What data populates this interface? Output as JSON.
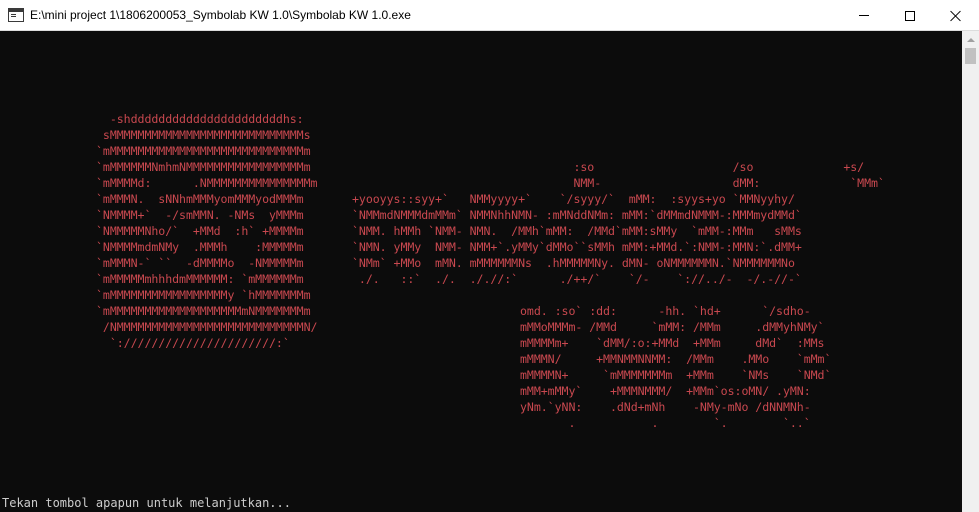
{
  "window": {
    "title": "E:\\mini project 1\\1806200053_Symbolab KW 1.0\\Symbolab KW 1.0.exe",
    "icon": "console-window-icon",
    "controls": [
      "minimize",
      "maximize",
      "close"
    ]
  },
  "console": {
    "text_color": "#c8484f",
    "background": "#0c0c0c",
    "ascii_logo_left": "  -shddddddddddddddddddddddhs:\n sMMMMMMMMMMMMMMMMMMMMMMMMMMMMs\n`mMMMMMMMMMMMMMMMMMMMMMMMMMMMMm\n`mMMMMMMNmhmNMMMMMMMMMMMMMMMMMm\n`mMMMMd:      .NMMMMMMMMMMMMMMMm\n`mMMMN.  sNNhmMMMyomMMMyodMMMm\n`NMMMM+`  -/smMMN. -NMs  yMMMm\n`NMMMMMNho/`  +MMd  :h` +MMMMm\n`NMMMMmdmNMy  .MMMh    :MMMMMm\n`mMMMN-` ``  -dMMMMo  -NMMMMMm\n`mMMMMMmhhhdmMMMMMM: `mMMMMMMm\n`mMMMMMMMMMMMMMMMMMy `hMMMMMMMm\n`mMMMMMMMMMMMMMMMMMMMmNMMMMMMMm\n /NMMMMMMMMMMMMMMMMMMMMMMMMMMMN/\n  `://////////////////////:`",
    "ascii_logo_right": "                                :so                    /so             +s/\n                                NMM-                   dMM:             `MMm`\n+yooyys::syy+`   NMMyyyy+`    `/syyy/`  mMM:  :syys+yo `MMNyyhy/\n`NMMmdNMMMdmMMm` NMMNhhNMN- :mMNddNMm: mMM:`dMMmdNMMM-:MMMmydMMd`\n`NMM. hMMh `NMM- NMN.  /MMh`mMM:  /MMd`mMM:sMMy  `mMM-:MMm   sMMs\n`NMN. yMMy  NMM- NMM+`.yMMy`dMMo``sMMh mMM:+MMd.`:NMM-:MMN:`.dMM+\n`NMm` +MMo  mMN. mMMMMMMNs  .hMMMMMNy. dMN- oNMMMMMMN.`NMMMMMMNo\n ./.   ::`  ./.  ././/:`      ./++/`    `/-    `://../-  -/.-//-`",
    "ascii_logo_bottom": "omd. :so` :dd:      -hh. `hd+      `/sdho-\nmMMoMMMm- /MMd     `mMM: /MMm     .dMMyhNMy`\nmMMMMm+    `dMM/:o:+MMd  +MMm     dMd`  :MMs\nmMMMN/     +MMNMMNNMM:  /MMm    .MMo    `mMm`\nmMMMMN+     `mMMMMMMMm  +MMm    `NMs    `NMd`\nmMM+mMMy`    +MMMNMMM/  +MMm`os:oMN/ .yMN:\nyNm.`yNN:    .dNd+mNh    -NMy-mNo /dNNMNh-\n       .           .        `.        `..`",
    "prompt": "Tekan tombol apapun untuk melanjutkan..."
  }
}
